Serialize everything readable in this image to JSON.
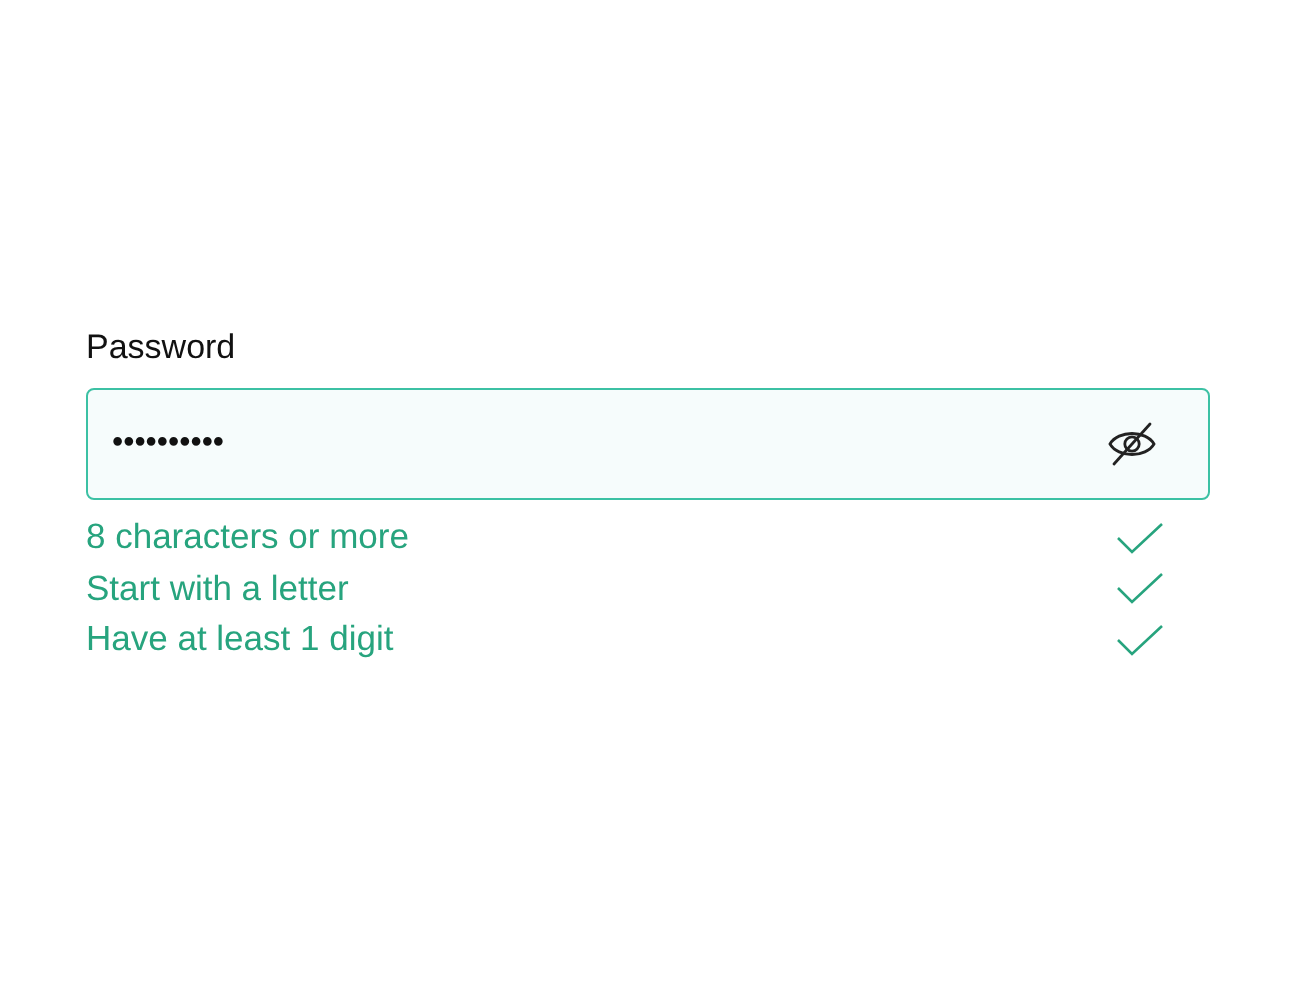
{
  "field": {
    "label": "Password",
    "value": "••••••••••",
    "visible": false
  },
  "rules": [
    {
      "text": "8 characters or more",
      "met": true
    },
    {
      "text": "Start with a letter",
      "met": true
    },
    {
      "text": "Have at least 1 digit",
      "met": true
    }
  ]
}
